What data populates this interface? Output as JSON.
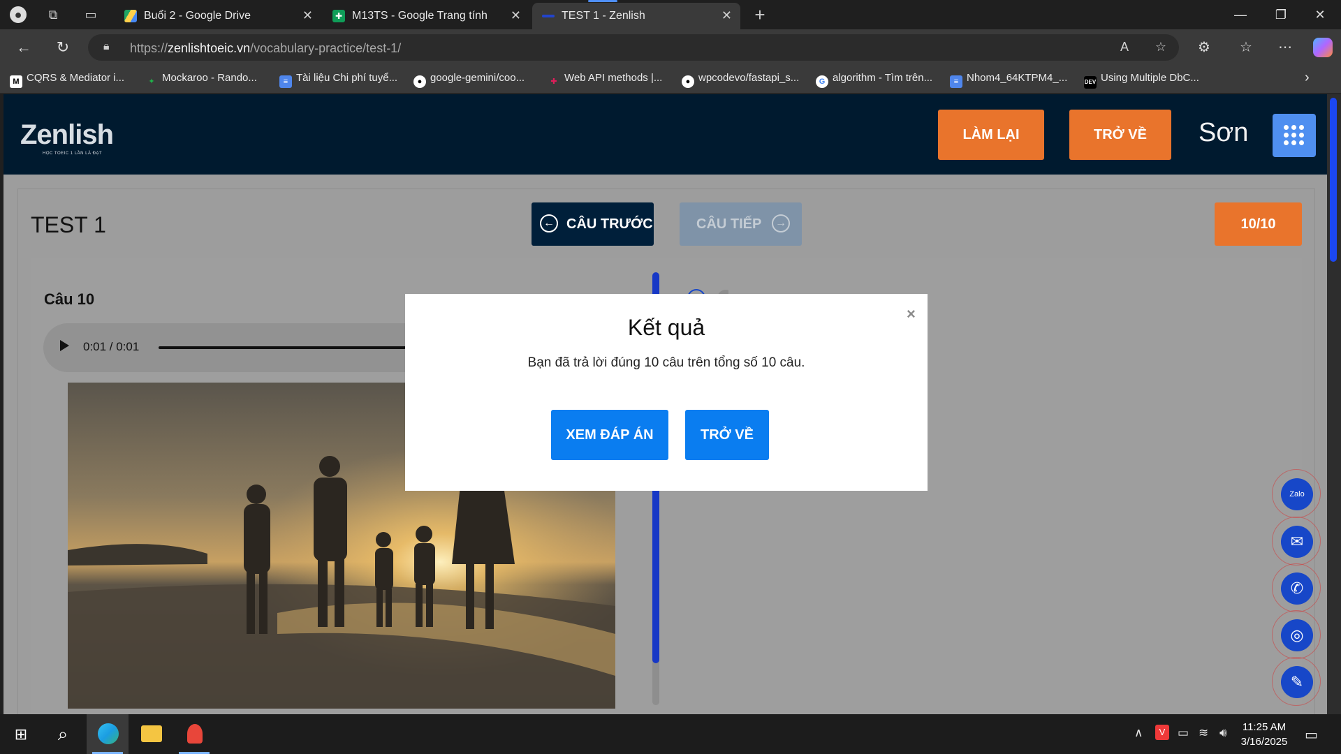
{
  "browser": {
    "tabs": [
      {
        "label": "Buổi 2 - Google Drive",
        "icon": "google-drive-icon"
      },
      {
        "label": "M13TS - Google Trang tính",
        "icon": "google-sheets-icon"
      },
      {
        "label": "TEST 1 - Zenlish",
        "icon": "zenlish-icon",
        "active": true
      }
    ],
    "url_scheme": "https://",
    "url_host": "zenlishtoeic.vn",
    "url_path": "/vocabulary-practice/test-1/",
    "bookmarks": [
      {
        "label": "CQRS & Mediator i...",
        "icon": "medium-icon"
      },
      {
        "label": "Mockaroo - Rando...",
        "icon": "mockaroo-icon"
      },
      {
        "label": "Tài liệu Chi phí tuyể...",
        "icon": "google-docs-icon"
      },
      {
        "label": "google-gemini/coo...",
        "icon": "github-icon"
      },
      {
        "label": "Web API methods |...",
        "icon": "slack-icon"
      },
      {
        "label": "wpcodevo/fastapi_s...",
        "icon": "github-icon"
      },
      {
        "label": "algorithm - Tìm trên...",
        "icon": "google-icon"
      },
      {
        "label": "Nhom4_64KTPM4_...",
        "icon": "google-docs-icon"
      },
      {
        "label": "Using Multiple DbC...",
        "icon": "dev-icon"
      }
    ]
  },
  "site": {
    "logo": "Zenlish",
    "logo_tagline": "HỌC TOEIC 1 LẦN LÀ ĐẠT",
    "retry_label": "LÀM LẠI",
    "back_label": "TRỞ VỀ",
    "user_name": "Sơn"
  },
  "test": {
    "title": "TEST 1",
    "prev_label": "CÂU TRƯỚC",
    "next_label": "CÂU TIẾP",
    "score": "10/10",
    "question_label": "Câu 10",
    "audio_time": "0:01 / 0:01"
  },
  "modal": {
    "title": "Kết quả",
    "message": "Bạn đã trả lời đúng 10 câu trên tổng số 10 câu.",
    "view_answers_label": "XEM ĐÁP ÁN",
    "back_label": "TRỞ VỀ",
    "close_symbol": "×"
  },
  "social_buttons": [
    {
      "name": "zalo-icon",
      "glyph": "Zalo"
    },
    {
      "name": "messenger-icon",
      "glyph": "✉"
    },
    {
      "name": "phone-icon",
      "glyph": "✆"
    },
    {
      "name": "instagram-icon",
      "glyph": "◎"
    },
    {
      "name": "notes-icon",
      "glyph": "✎"
    }
  ],
  "taskbar": {
    "time": "11:25 AM",
    "date": "3/16/2025"
  },
  "colors": {
    "orange": "#e9742c",
    "navy": "#001a2f",
    "modal_blue": "#0a7df0",
    "next_disabled": "#7f93a8"
  }
}
